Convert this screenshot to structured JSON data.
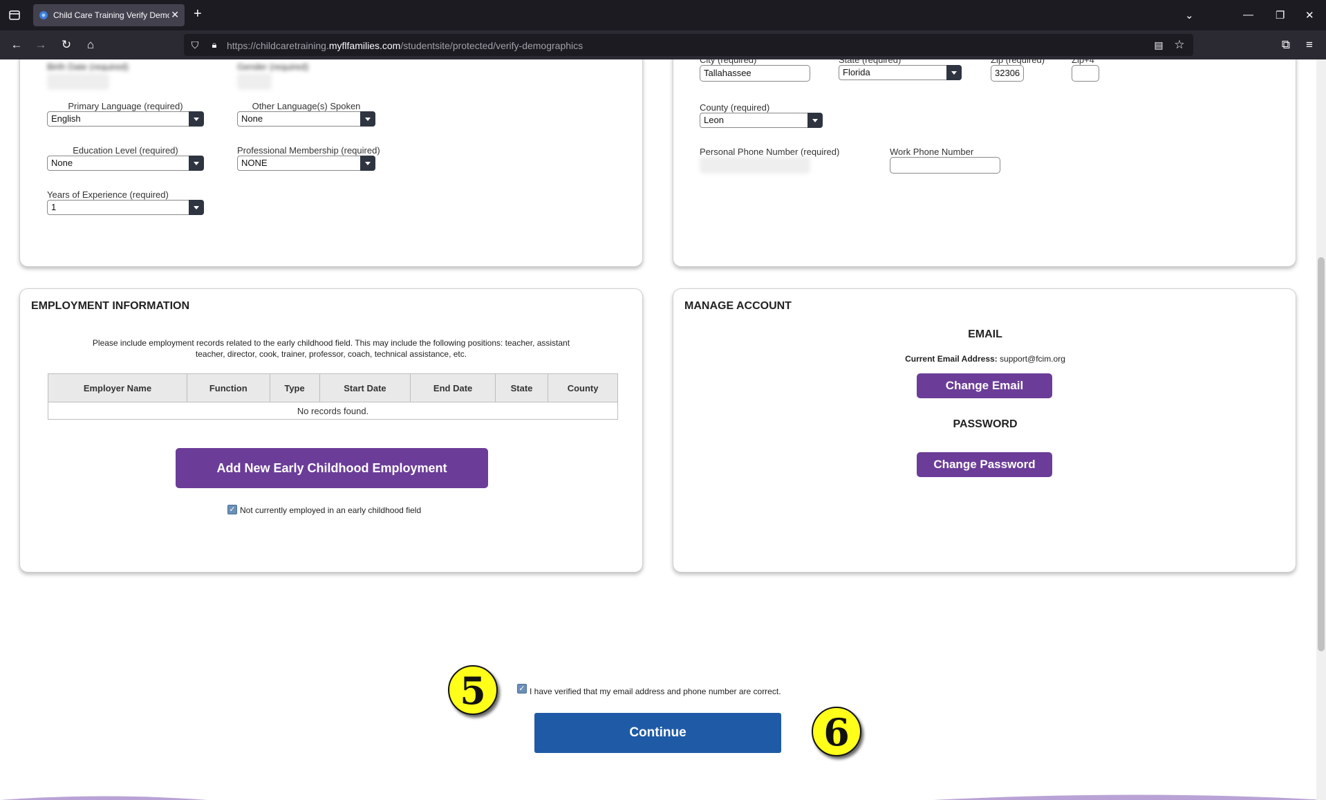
{
  "browser": {
    "tab_title": "Child Care Training Verify Demographics",
    "url_prefix": "https://childcaretraining.",
    "url_domain": "myflfamilies.com",
    "url_path": "/studentsite/protected/verify-demographics"
  },
  "personal": {
    "partial_top_left_1": "Birth Date (required)",
    "partial_top_left_2": "Gender (required)",
    "primary_language_label": "Primary Language (required)",
    "primary_language_value": "English",
    "other_language_label": "Other Language(s) Spoken",
    "other_language_value": "None",
    "education_label": "Education Level (required)",
    "education_value": "None",
    "membership_label": "Professional Membership (required)",
    "membership_value": "NONE",
    "experience_label": "Years of Experience (required)",
    "experience_value": "1"
  },
  "address": {
    "city_label": "City (required)",
    "city_value": "Tallahassee",
    "state_label": "State (required)",
    "state_value": "Florida",
    "zip_label": "Zip (required)",
    "zip_value": "32306",
    "zip4_label": "Zip+4",
    "county_label": "County (required)",
    "county_value": "Leon",
    "personal_phone_label": "Personal Phone Number (required)",
    "work_phone_label": "Work Phone Number"
  },
  "employment": {
    "title": "EMPLOYMENT INFORMATION",
    "description": "Please include employment records related to the early childhood field. This may include the following positions: teacher, assistant teacher, director, cook, trainer, professor, coach, technical assistance, etc.",
    "columns": [
      "Employer Name",
      "Function",
      "Type",
      "Start Date",
      "End Date",
      "State",
      "County"
    ],
    "empty_message": "No records found.",
    "add_button": "Add New Early Childhood Employment",
    "not_employed_label": "Not currently employed in an early childhood field",
    "not_employed_checked": true
  },
  "account": {
    "title": "MANAGE ACCOUNT",
    "email_heading": "EMAIL",
    "current_email_label": "Current Email Address:",
    "current_email_value": "support@fcim.org",
    "change_email_button": "Change Email",
    "password_heading": "PASSWORD",
    "change_password_button": "Change Password"
  },
  "verify": {
    "label": "I have verified that my email address and phone number are correct.",
    "checked": true,
    "continue_button": "Continue"
  },
  "annotations": {
    "step5": "5",
    "step6": "6"
  },
  "colors": {
    "purple": "#6b3d98",
    "blue": "#1f5aa6",
    "badge_yellow": "#ffff1a"
  }
}
